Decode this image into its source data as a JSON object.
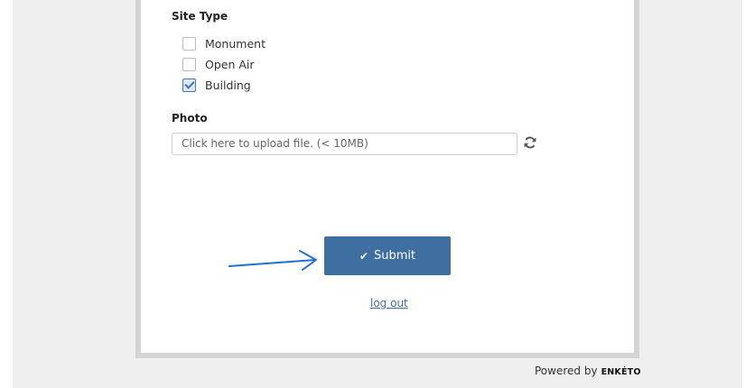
{
  "site_type": {
    "label": "Site Type",
    "options": [
      {
        "label": "Monument",
        "checked": false
      },
      {
        "label": "Open Air",
        "checked": false
      },
      {
        "label": "Building",
        "checked": true
      }
    ]
  },
  "photo": {
    "label": "Photo",
    "placeholder": "Click here to upload file. (< 10MB)",
    "refresh_icon": "refresh-icon"
  },
  "submit": {
    "label": "Submit",
    "icon": "checkmark-icon",
    "color": "#3f6fa0"
  },
  "annotation": {
    "icon": "arrow-right-icon",
    "color": "#1f6fdb"
  },
  "logout": {
    "label": "log out"
  },
  "footer": {
    "powered_by": "Powered by",
    "brand": "ENKÉTO"
  }
}
